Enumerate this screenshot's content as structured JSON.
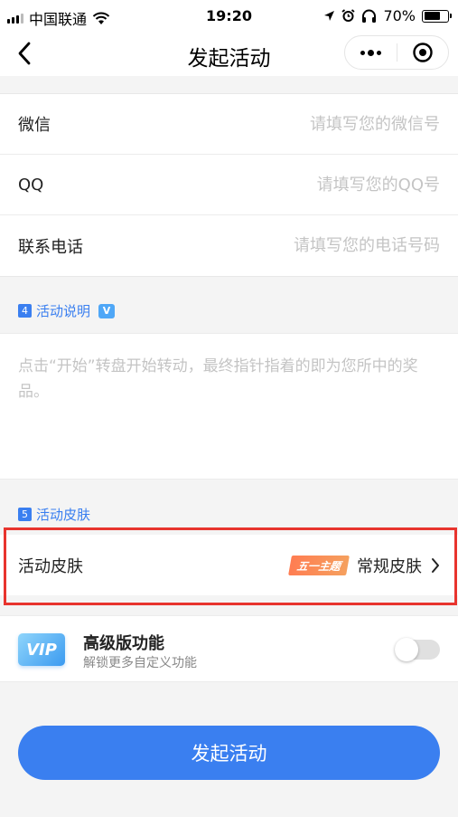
{
  "status_bar": {
    "carrier": "中国联通",
    "time": "19:20",
    "battery_percent": "70%",
    "battery_level": 0.7,
    "signal_icon": "signal-icon",
    "wifi_icon": "wifi-icon",
    "location_icon": "location-arrow-icon",
    "alarm_icon": "alarm-icon",
    "headphones_icon": "headphones-icon"
  },
  "nav": {
    "title": "发起活动",
    "back_icon": "back-chevron-icon",
    "more_icon": "more-dots-icon",
    "close_icon": "miniprogram-close-icon"
  },
  "contact_fields": [
    {
      "label": "微信",
      "placeholder": "请填写您的微信号",
      "value": ""
    },
    {
      "label": "QQ",
      "placeholder": "请填写您的QQ号",
      "value": ""
    },
    {
      "label": "联系电话",
      "placeholder": "请填写您的电话号码",
      "value": ""
    }
  ],
  "section_description": {
    "number": "4",
    "title": "活动说明",
    "badge": "V",
    "placeholder": "点击“开始”转盘开始转动，最终指针指着的即为您所中的奖品。"
  },
  "section_skin": {
    "number": "5",
    "title": "活动皮肤",
    "row_label": "活动皮肤",
    "theme_tag": "五一主题",
    "selected_value": "常规皮肤",
    "chevron_icon": "chevron-right-icon"
  },
  "vip": {
    "badge": "VIP",
    "title": "高级版功能",
    "subtitle": "解锁更多自定义功能",
    "enabled": false
  },
  "submit_label": "发起活动",
  "colors": {
    "accent": "#3a7ff0",
    "highlight_frame": "#e8342e",
    "theme_tag": "#ff7d52"
  }
}
